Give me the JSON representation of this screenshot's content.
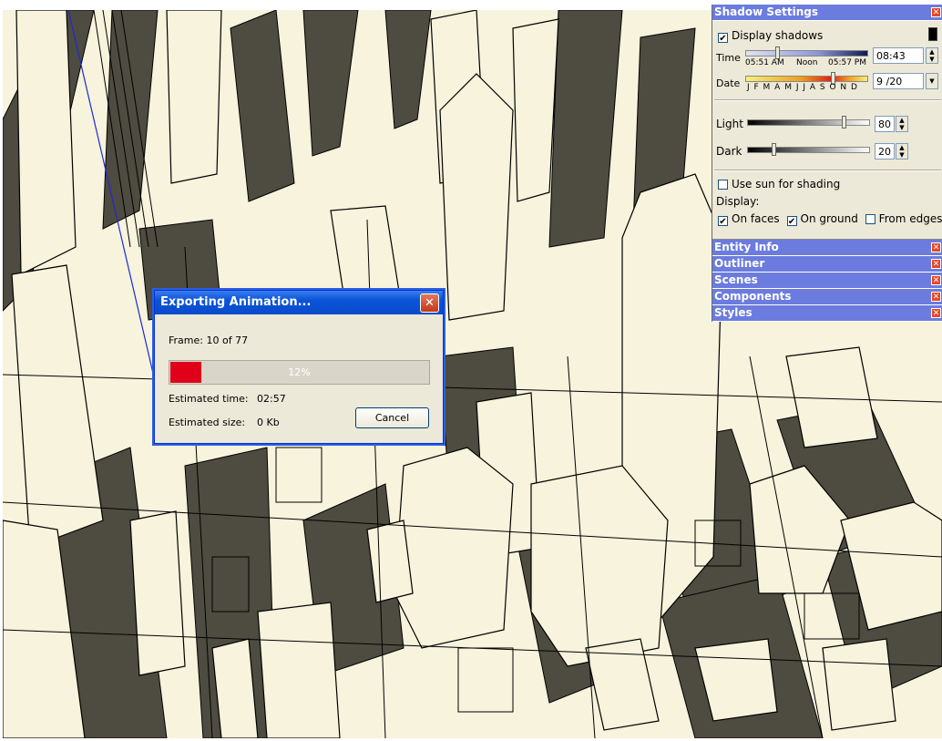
{
  "shadow_panel": {
    "title": "Shadow Settings",
    "display_shadows_label": "Display shadows",
    "time_label": "Time",
    "time_ticks": [
      "05:51 AM",
      "Noon",
      "05:57 PM"
    ],
    "time_value": "08:43",
    "date_label": "Date",
    "date_ticks": "J F M A M J J A S O N D",
    "date_value": "9 /20",
    "light_label": "Light",
    "light_value": "80",
    "dark_label": "Dark",
    "dark_value": "20",
    "use_sun_label": "Use sun for shading",
    "display_label": "Display:",
    "on_faces_label": "On faces",
    "on_ground_label": "On ground",
    "from_edges_label": "From edges",
    "display_shadows_checked": true,
    "use_sun_checked": false,
    "on_faces_checked": true,
    "on_ground_checked": true,
    "from_edges_checked": false
  },
  "collapsed_panels": [
    "Entity Info",
    "Outliner",
    "Scenes",
    "Components",
    "Styles"
  ],
  "export_dialog": {
    "title": "Exporting Animation...",
    "frame_text": "Frame: 10 of 77",
    "progress_text": "12%",
    "progress_fraction": 0.12,
    "estimated_time_label": "Estimated time:",
    "estimated_time_value": "02:57",
    "estimated_size_label": "Estimated size:",
    "estimated_size_value": "0 Kb",
    "cancel_label": "Cancel"
  },
  "colors": {
    "panel_title": "#6b7cde",
    "progress_fill": "#e0001a",
    "building_light": "#f7f3dc",
    "building_shadow": "#4e4b40"
  },
  "icons": [
    "close-icon",
    "check-icon",
    "spin-up-icon",
    "spin-down-icon",
    "dropdown-arrow-icon",
    "collapse-panel-icon"
  ]
}
